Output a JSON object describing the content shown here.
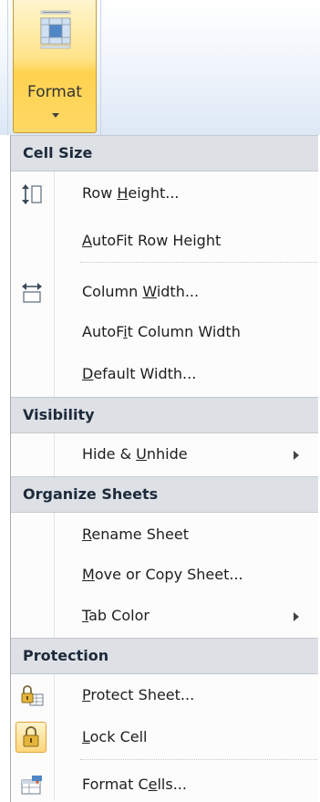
{
  "ribbon": {
    "format_label": "Format",
    "format_icon": "format-cells-grid-icon"
  },
  "menu": {
    "sections": {
      "cell_size": "Cell Size",
      "visibility": "Visibility",
      "organize": "Organize Sheets",
      "protection": "Protection"
    },
    "items": {
      "row_height": {
        "pre": "Row ",
        "u": "H",
        "post": "eight...",
        "icon": "row-height-icon"
      },
      "autofit_row": {
        "pre": "",
        "u": "A",
        "post": "utoFit Row Height"
      },
      "column_width": {
        "pre": "Column ",
        "u": "W",
        "post": "idth...",
        "icon": "column-width-icon"
      },
      "autofit_col": {
        "pre": "AutoF",
        "u": "i",
        "post": "t Column Width"
      },
      "default_width": {
        "pre": "",
        "u": "D",
        "post": "efault Width..."
      },
      "hide_unhide": {
        "pre": "Hide & ",
        "u": "U",
        "post": "nhide",
        "has_submenu": true
      },
      "rename_sheet": {
        "pre": "",
        "u": "R",
        "post": "ename Sheet"
      },
      "move_copy": {
        "pre": "",
        "u": "M",
        "post": "ove or Copy Sheet..."
      },
      "tab_color": {
        "pre": "",
        "u": "T",
        "post": "ab Color",
        "has_submenu": true
      },
      "protect_sheet": {
        "pre": "",
        "u": "P",
        "post": "rotect Sheet...",
        "icon": "protect-sheet-icon"
      },
      "lock_cell": {
        "pre": "",
        "u": "L",
        "post": "ock Cell",
        "icon": "lock-icon"
      },
      "format_cells": {
        "pre": "Format C",
        "u": "e",
        "post": "lls...",
        "icon": "format-cells-icon"
      }
    }
  },
  "colors": {
    "highlight_gold": "#ffd24f",
    "section_bg": "#dde1e6",
    "section_text": "#1e2a3a",
    "ribbon_blue": "#dde8f5"
  }
}
